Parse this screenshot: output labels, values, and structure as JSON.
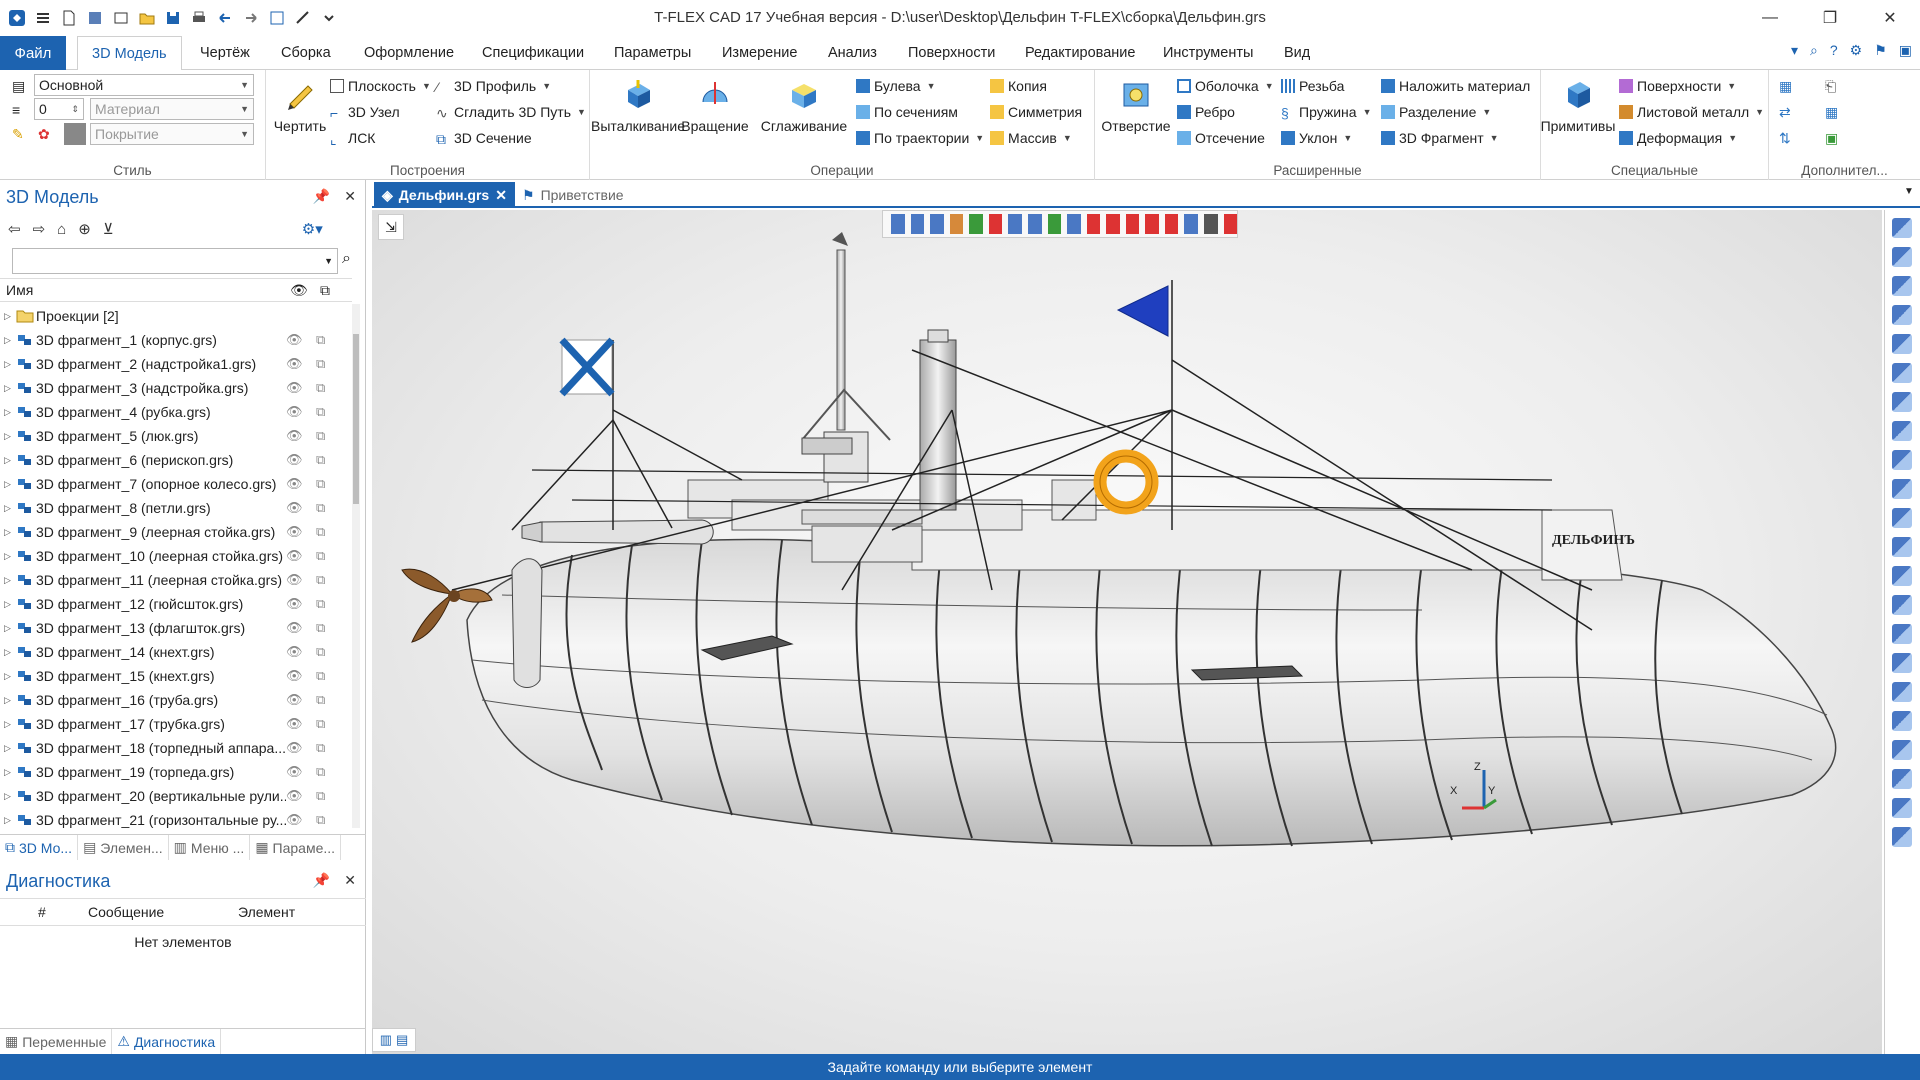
{
  "window": {
    "title": "T-FLEX CAD 17 Учебная версия - D:\\user\\Desktop\\Дельфин T-FLEX\\сборка\\Дельфин.grs"
  },
  "ribbon_tabs": [
    "Файл",
    "3D Модель",
    "Чертёж",
    "Сборка",
    "Оформление",
    "Спецификации",
    "Параметры",
    "Измерение",
    "Анализ",
    "Поверхности",
    "Редактирование",
    "Инструменты",
    "Вид"
  ],
  "ribbon": {
    "style": {
      "name": "Стиль",
      "layer": "Основной",
      "level": "0",
      "material_placeholder": "Материал",
      "coating_placeholder": "Покрытие"
    },
    "build": {
      "name": "Построения",
      "draw": "Чертить",
      "plane": "Плоскость",
      "node3d": "3D Узел",
      "lsk": "ЛСК",
      "profile3d": "3D Профиль",
      "smooth_path": "Сгладить 3D Путь",
      "section3d": "3D Сечение"
    },
    "ops": {
      "name": "Операции",
      "extrude": "Выталкивание",
      "rotate": "Вращение",
      "loft": "Сглаживание",
      "boolean": "Булева",
      "by_sections": "По сечениям",
      "by_path": "По траектории",
      "copy": "Копия",
      "symmetry": "Симметрия",
      "array": "Массив"
    },
    "ext": {
      "name": "Расширенные",
      "hole": "Отверстие",
      "shell": "Оболочка",
      "rib": "Ребро",
      "cut": "Отсечение",
      "thread": "Резьба",
      "spring": "Пружина",
      "slope": "Уклон",
      "apply_material": "Наложить материал",
      "split": "Разделение",
      "fragment3d": "3D Фрагмент"
    },
    "spec": {
      "name": "Специальные",
      "primitives": "Примитивы",
      "surfaces": "Поверхности",
      "sheet_metal": "Листовой металл",
      "deform": "Деформация"
    },
    "extra": {
      "name": "Дополнител..."
    }
  },
  "left_panel": {
    "title": "3D Модель",
    "column_name": "Имя",
    "tree": [
      "Проекции [2]",
      "3D фрагмент_1 (корпус.grs)",
      "3D фрагмент_2 (надстройка1.grs)",
      "3D фрагмент_3 (надстройка.grs)",
      "3D фрагмент_4 (рубка.grs)",
      "3D фрагмент_5 (люк.grs)",
      "3D фрагмент_6 (перископ.grs)",
      "3D фрагмент_7 (опорное колесо.grs)",
      "3D фрагмент_8 (петли.grs)",
      "3D фрагмент_9 (леерная стойка.grs)",
      "3D фрагмент_10 (леерная стойка.grs)",
      "3D фрагмент_11 (леерная стойка.grs)",
      "3D фрагмент_12 (гюйсшток.grs)",
      "3D фрагмент_13 (флагшток.grs)",
      "3D фрагмент_14 (кнехт.grs)",
      "3D фрагмент_15 (кнехт.grs)",
      "3D фрагмент_16 (труба.grs)",
      "3D фрагмент_17 (трубка.grs)",
      "3D фрагмент_18 (торпедный аппара...",
      "3D фрагмент_19 (торпеда.grs)",
      "3D фрагмент_20 (вертикальные рули...",
      "3D фрагмент_21 (горизонтальные ру..."
    ],
    "tabs": [
      "3D Мо...",
      "Элемен...",
      "Меню ...",
      "Параме..."
    ]
  },
  "diag_panel": {
    "title": "Диагностика",
    "col_num": "#",
    "col_msg": "Сообщение",
    "col_elem": "Элемент",
    "empty": "Нет элементов",
    "tabs": [
      "Переменные",
      "Диагностика"
    ]
  },
  "doc_tabs": [
    "Дельфин.grs",
    "Приветствие"
  ],
  "model": {
    "nameplate": "ДЕЛЬФИНЪ"
  },
  "axes": {
    "z": "Z",
    "x": "X",
    "y": "Y"
  },
  "status": "Задайте команду или выберите элемент",
  "colors": {
    "accent": "#1d63b0",
    "flag_blue": "#1f3fbf",
    "lifebuoy": "#f2a31b",
    "propeller": "#8b5a2b"
  }
}
